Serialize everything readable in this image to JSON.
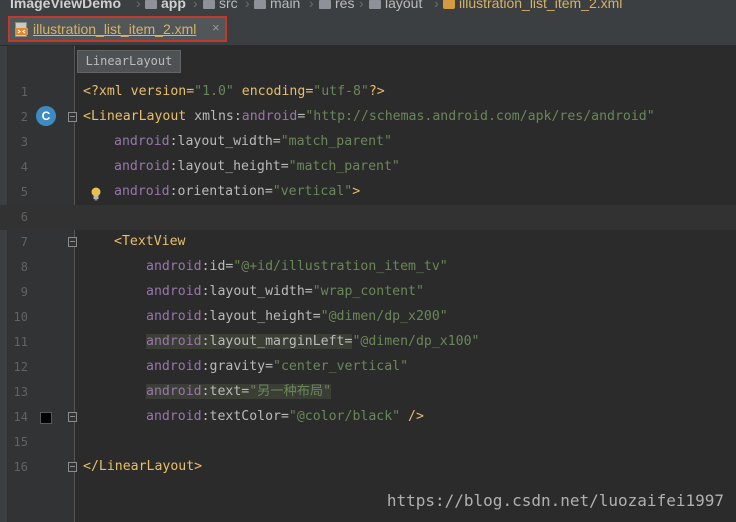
{
  "breadcrumb": {
    "items": [
      "ImageViewDemo",
      "app",
      "src",
      "main",
      "res",
      "layout",
      "illustration_list_item_2.xml"
    ]
  },
  "tab": {
    "label": "illustration_list_item_2.xml",
    "close": "×"
  },
  "tooltip": "LinearLayout",
  "line_numbers": [
    "1",
    "2",
    "3",
    "4",
    "5",
    "6",
    "7",
    "8",
    "9",
    "10",
    "11",
    "12",
    "13",
    "14",
    "15",
    "16"
  ],
  "gutter_icons": {
    "class_badge": "C"
  },
  "code": {
    "l1": {
      "a": "<?xml version=",
      "b": "\"1.0\"",
      "c": " encoding=",
      "d": "\"utf-8\"",
      "e": "?>"
    },
    "l2": {
      "open": "<LinearLayout",
      "ns": " xmlns:",
      "nsname": "android",
      "eq": "=",
      "val": "\"http://schemas.android.com/apk/res/android\""
    },
    "l3": {
      "ns": "android",
      "attr": ":layout_width=",
      "val": "\"match_parent\""
    },
    "l4": {
      "ns": "android",
      "attr": ":layout_height=",
      "val": "\"match_parent\""
    },
    "l5": {
      "ns": "android",
      "attr": ":orientation=",
      "val": "\"vertical\"",
      "close": ">"
    },
    "l7": {
      "open": "<TextView"
    },
    "l8": {
      "ns": "android",
      "attr": ":id=",
      "val": "\"@+id/illustration_item_tv\""
    },
    "l9": {
      "ns": "android",
      "attr": ":layout_width=",
      "val": "\"wrap_content\""
    },
    "l10": {
      "ns": "android",
      "attr": ":layout_height=",
      "val": "\"@dimen/dp_x200\""
    },
    "l11": {
      "ns": "android",
      "attr": ":layout_marginLeft=",
      "val": "\"@dimen/dp_x100\""
    },
    "l12": {
      "ns": "android",
      "attr": ":gravity=",
      "val": "\"center_vertical\""
    },
    "l13": {
      "ns": "android",
      "attr": ":text=",
      "val": "\"另一种布局\""
    },
    "l14": {
      "ns": "android",
      "attr": ":textColor=",
      "val": "\"@color/black\"",
      "close": " />"
    },
    "l16": {
      "close": "</LinearLayout>"
    }
  },
  "watermark": "https://blog.csdn.net/luozaifei1997",
  "colors": {
    "tag": "#e8bf6a",
    "attribute_namespace": "#9876aa",
    "string_value": "#6a8759",
    "tab_highlight": "#c0392b"
  }
}
